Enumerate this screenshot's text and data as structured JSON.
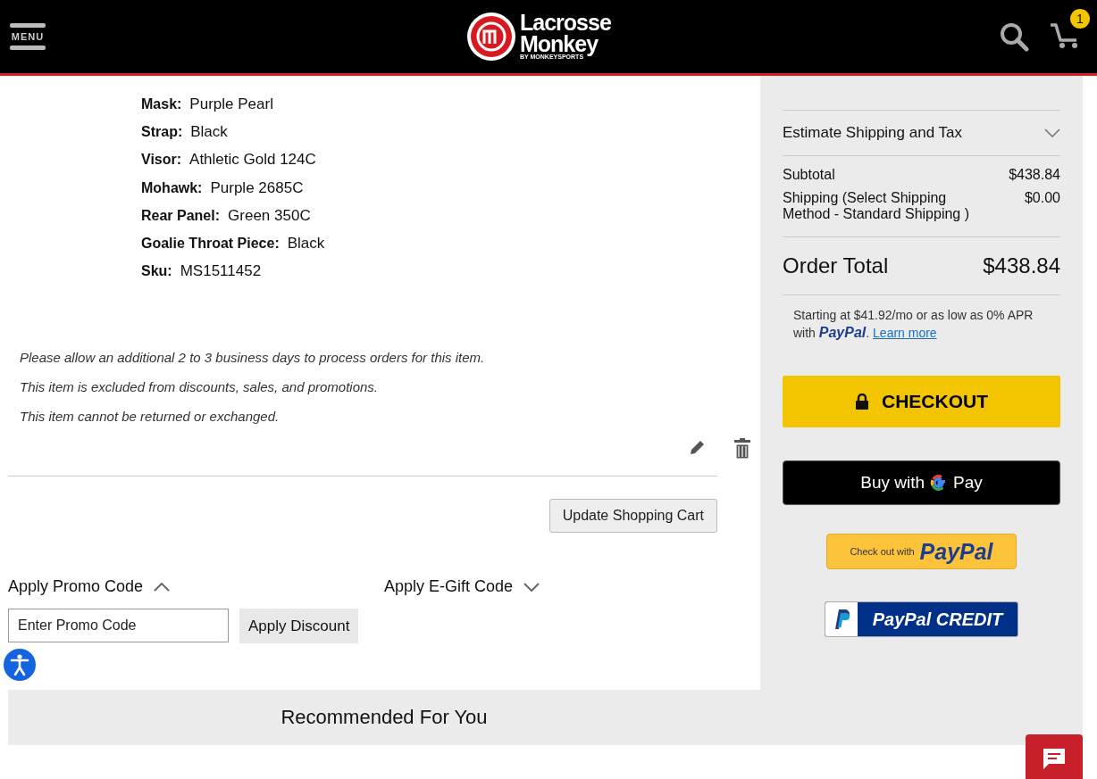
{
  "header": {
    "menu_label": "MENU",
    "logo": {
      "line1": "Lacrosse",
      "line2": "Monkey",
      "tagline": "BY MONKEYSPORTS"
    },
    "cart_count": "1"
  },
  "item": {
    "specs": [
      {
        "label": "Mask:",
        "value": "Purple Pearl"
      },
      {
        "label": "Strap:",
        "value": "Black"
      },
      {
        "label": "Visor:",
        "value": "Athletic Gold 124C"
      },
      {
        "label": "Mohawk:",
        "value": "Purple 2685C"
      },
      {
        "label": "Rear Panel:",
        "value": "Green 350C"
      },
      {
        "label": "Goalie Throat Piece:",
        "value": "Black"
      },
      {
        "label": "Sku:",
        "value": "MS1511452"
      }
    ],
    "notes": [
      "Please allow an additional 2 to 3 business days to process orders for this item.",
      "This item is excluded from discounts, sales, and promotions.",
      "This item cannot be returned or exchanged."
    ]
  },
  "update_button": "Update Shopping Cart",
  "codes": [
    {
      "label": "Apply Promo Code",
      "expanded": true
    },
    {
      "label": "Apply E-Gift Code",
      "expanded": false
    }
  ],
  "promo": {
    "placeholder": "Enter Promo Code",
    "button": "Apply Discount"
  },
  "recommended": "Recommended For You",
  "summary": {
    "estimate": {
      "label": "Estimate Shipping and Tax",
      "expanded": false
    },
    "lines": [
      {
        "label": "Subtotal",
        "value": "$438.84"
      },
      {
        "label": "Shipping (Select Shipping Method - Standard Shipping )",
        "value": "$0.00"
      }
    ],
    "total": {
      "label": "Order Total",
      "value": "$438.84"
    },
    "financing": {
      "text": "Starting at $41.92/mo or as low as 0% APR with",
      "brand": "PayPal",
      "brand_suffix": ".",
      "link": "Learn more"
    },
    "checkout": "CHECKOUT",
    "gpay": {
      "text": "Buy with",
      "brand": "Pay"
    },
    "paypal": {
      "text": "Check out with",
      "brand": "PayPal"
    },
    "paypal_credit": "PayPal CREDIT"
  }
}
